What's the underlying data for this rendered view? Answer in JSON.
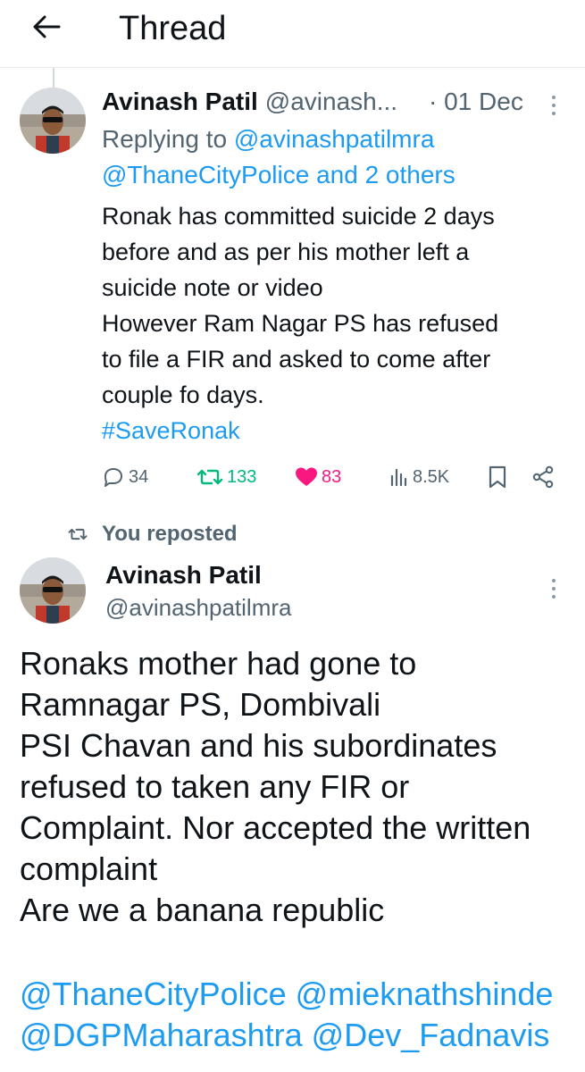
{
  "header": {
    "title": "Thread",
    "back_icon": "arrow-left-icon"
  },
  "tweet1": {
    "display_name": "Avinash Patil",
    "handle": "@avinash...",
    "date": "· 01 Dec",
    "replying_label": "Replying to",
    "replying_to_1": "@avinashpatilmra",
    "replying_to_2": "@ThaneCityPolice and 2 others",
    "text_lines": [
      "Ronak has committed suicide 2 days",
      "before and as per his mother left a",
      "suicide note or video",
      "However Ram Nagar PS has refused",
      "to file a FIR and asked to come after",
      "couple fo days."
    ],
    "hashtag": "#SaveRonak",
    "replies": "34",
    "reposts": "133",
    "likes": "83",
    "views": "8.5K"
  },
  "repost_label": "You reposted",
  "tweet2": {
    "display_name": "Avinash Patil",
    "handle": "@avinashpatilmra",
    "text_lines": [
      "Ronaks mother had gone to",
      "Ramnagar PS, Dombivali",
      "PSI Chavan and his subordinates",
      "refused to taken any FIR or",
      "Complaint. Nor accepted the written",
      "complaint",
      "Are we a banana republic"
    ],
    "mentions_line_1": "@ThaneCityPolice @mieknathshinde",
    "mentions_line_2": "@DGPMaharashtra @Dev_Fadnavis"
  },
  "colors": {
    "text": "#0f1419",
    "muted": "#536471",
    "link": "#1d9bf0",
    "repost_green": "#00ba7c",
    "like_pink": "#f91880",
    "divider": "#e7e9ea"
  }
}
